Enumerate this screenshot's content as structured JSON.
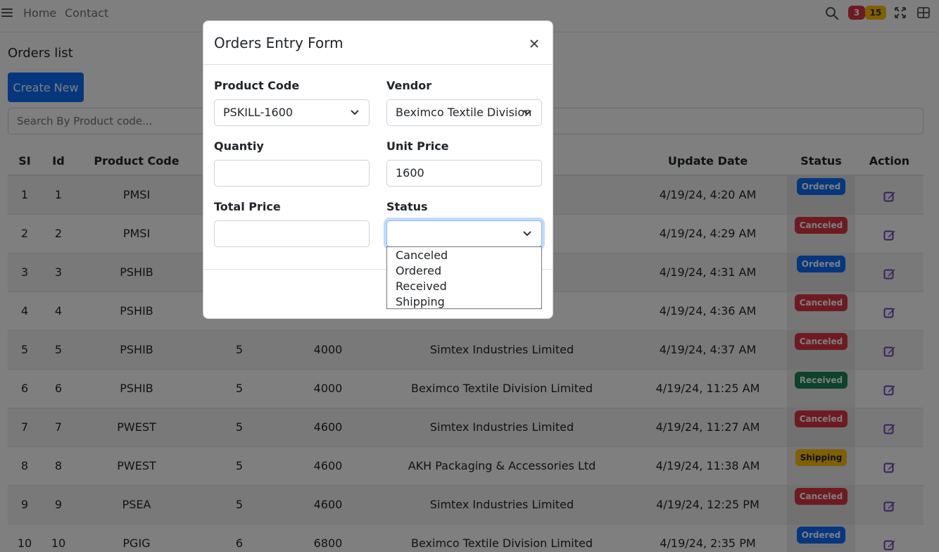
{
  "nav": {
    "links": [
      "Home",
      "Contact"
    ],
    "badge_red": "3",
    "badge_yellow": "15"
  },
  "page": {
    "title": "Orders list",
    "create_button": "Create New",
    "search_placeholder": "Search By Product code..."
  },
  "table": {
    "headers": {
      "si": "SI",
      "id": "Id",
      "product_code": "Product Code",
      "quantity": "",
      "unit_price": "",
      "vendor": "",
      "update_date": "Update Date",
      "status": "Status",
      "action": "Action"
    },
    "rows": [
      {
        "si": "1",
        "id": "1",
        "code": "PMSI",
        "qty": "",
        "price": "",
        "vendor": "ited",
        "date": "4/19/24, 4:20 AM",
        "status": "Ordered"
      },
      {
        "si": "2",
        "id": "2",
        "code": "PMSI",
        "qty": "",
        "price": "",
        "vendor": "ries Ltd",
        "date": "4/19/24, 4:29 AM",
        "status": "Canceled"
      },
      {
        "si": "3",
        "id": "3",
        "code": "PSHIB",
        "qty": "",
        "price": "",
        "vendor": "ited",
        "date": "4/19/24, 4:31 AM",
        "status": "Ordered"
      },
      {
        "si": "4",
        "id": "4",
        "code": "PSHIB",
        "qty": "",
        "price": "",
        "vendor": "",
        "date": "4/19/24, 4:36 AM",
        "status": "Canceled"
      },
      {
        "si": "5",
        "id": "5",
        "code": "PSHIB",
        "qty": "5",
        "price": "4000",
        "vendor": "Simtex Industries Limited",
        "date": "4/19/24, 4:37 AM",
        "status": "Canceled"
      },
      {
        "si": "6",
        "id": "6",
        "code": "PSHIB",
        "qty": "5",
        "price": "4000",
        "vendor": "Beximco Textile Division Limited",
        "date": "4/19/24, 11:25 AM",
        "status": "Received"
      },
      {
        "si": "7",
        "id": "7",
        "code": "PWEST",
        "qty": "5",
        "price": "4600",
        "vendor": "Simtex Industries Limited",
        "date": "4/19/24, 11:27 AM",
        "status": "Canceled"
      },
      {
        "si": "8",
        "id": "8",
        "code": "PWEST",
        "qty": "5",
        "price": "4600",
        "vendor": "AKH Packaging & Accessories Ltd",
        "date": "4/19/24, 11:38 AM",
        "status": "Shipping"
      },
      {
        "si": "9",
        "id": "9",
        "code": "PSEA",
        "qty": "5",
        "price": "4600",
        "vendor": "Simtex Industries Limited",
        "date": "4/19/24, 12:25 PM",
        "status": "Canceled"
      },
      {
        "si": "10",
        "id": "10",
        "code": "PGIG",
        "qty": "6",
        "price": "6800",
        "vendor": "Beximco Textile Division Limited",
        "date": "4/19/24, 2:35 PM",
        "status": "Ordered"
      }
    ]
  },
  "modal": {
    "title": "Orders Entry Form",
    "close_symbol": "×",
    "product_code_label": "Product Code",
    "product_code_value": "PSKILL-1600",
    "vendor_label": "Vendor",
    "vendor_value": "Beximco Textile Division",
    "quantity_label": "Quantiy",
    "quantity_value": "",
    "unit_price_label": "Unit Price",
    "unit_price_value": "1600",
    "total_price_label": "Total Price",
    "total_price_value": "",
    "status_label": "Status",
    "status_value": "",
    "status_options": [
      "Canceled",
      "Ordered",
      "Received",
      "Shipping"
    ]
  },
  "colors": {
    "primary": "#0d6efd",
    "danger": "#dc3545",
    "success": "#198754",
    "warning": "#ffc107",
    "edit_icon": "#6f42c1"
  }
}
